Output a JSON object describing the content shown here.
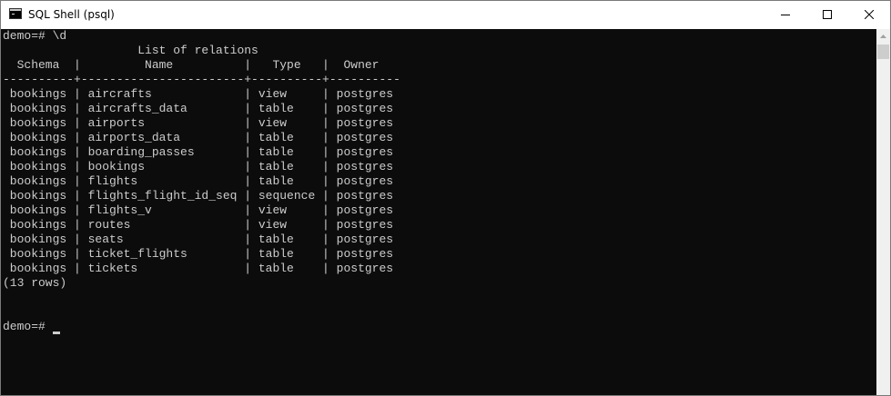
{
  "window": {
    "title": "SQL Shell (psql)",
    "icon": "console-icon"
  },
  "terminal": {
    "lines": [
      "demo=# \\d",
      "                   List of relations",
      "  Schema  |         Name          |   Type   |  Owner",
      "----------+-----------------------+----------+----------",
      " bookings | aircrafts             | view     | postgres",
      " bookings | aircrafts_data        | table    | postgres",
      " bookings | airports              | view     | postgres",
      " bookings | airports_data         | table    | postgres",
      " bookings | boarding_passes       | table    | postgres",
      " bookings | bookings              | table    | postgres",
      " bookings | flights               | table    | postgres",
      " bookings | flights_flight_id_seq | sequence | postgres",
      " bookings | flights_v             | view     | postgres",
      " bookings | routes                | view     | postgres",
      " bookings | seats                 | table    | postgres",
      " bookings | ticket_flights        | table    | postgres",
      " bookings | tickets               | table    | postgres",
      "(13 rows)",
      "",
      "",
      "demo=# "
    ]
  },
  "colors": {
    "console_bg": "#0c0c0c",
    "console_fg": "#cccccc"
  }
}
